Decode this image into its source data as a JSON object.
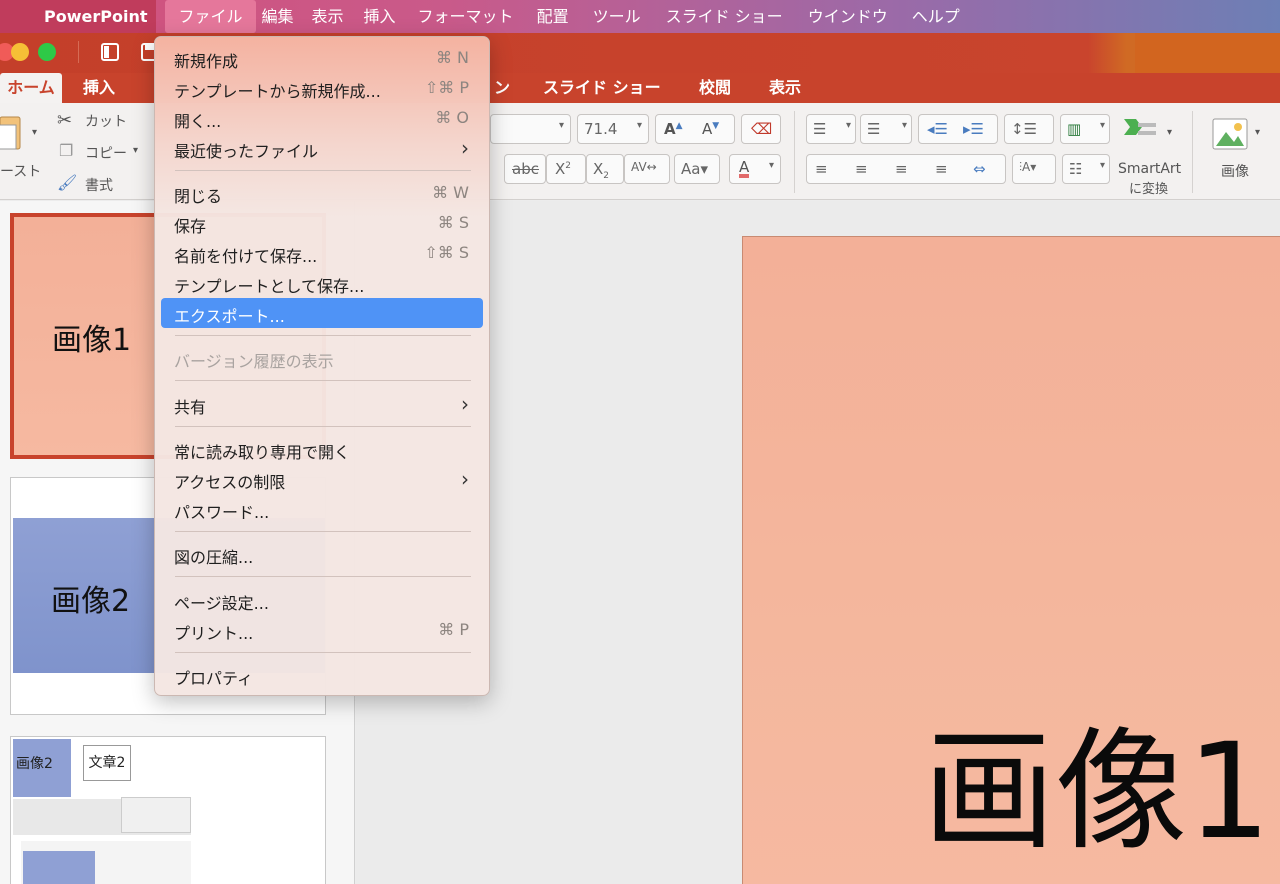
{
  "menubar": {
    "app": "PowerPoint",
    "items": [
      "ファイル",
      "編集",
      "表示",
      "挿入",
      "フォーマット",
      "配置",
      "ツール",
      "スライド ショー",
      "ウインドウ",
      "ヘルプ"
    ]
  },
  "ribbon_tabs": [
    "ホーム",
    "挿入",
    "ン",
    "スライド ショー",
    "校閲",
    "表示"
  ],
  "ribbon": {
    "paste": "ースト",
    "cut": "カット",
    "copy": "コピー",
    "format": "書式",
    "font_size": "71.4",
    "strikethrough": "abc",
    "smartart_line1": "SmartArt",
    "smartart_line2": "に変換",
    "picture": "画像"
  },
  "file_menu": {
    "items": [
      {
        "label": "新規作成",
        "shortcut": "⌘ N"
      },
      {
        "label": "テンプレートから新規作成...",
        "shortcut": "⇧⌘ P"
      },
      {
        "label": "開く...",
        "shortcut": "⌘ O"
      },
      {
        "label": "最近使ったファイル",
        "submenu": true
      },
      {
        "label": "閉じる",
        "shortcut": "⌘ W"
      },
      {
        "label": "保存",
        "shortcut": "⌘ S"
      },
      {
        "label": "名前を付けて保存...",
        "shortcut": "⇧⌘ S"
      },
      {
        "label": "テンプレートとして保存..."
      },
      {
        "label": "エクスポート...",
        "selected": true
      },
      {
        "label": "バージョン履歴の表示",
        "disabled": true
      },
      {
        "label": "共有",
        "submenu": true
      },
      {
        "label": "常に読み取り専用で開く"
      },
      {
        "label": "アクセスの制限",
        "submenu": true
      },
      {
        "label": "パスワード..."
      },
      {
        "label": "図の圧縮..."
      },
      {
        "label": "ページ設定..."
      },
      {
        "label": "プリント...",
        "shortcut": "⌘ P"
      },
      {
        "label": "プロパティ"
      }
    ]
  },
  "thumbnails": {
    "slide1": "画像1",
    "slide2": "画像2",
    "slide3_a": "画像2",
    "slide3_b": "文章2"
  },
  "slide": {
    "title": "画像1"
  },
  "colors": {
    "menubar_active": "#e5779b",
    "ribbon": "#c8432c",
    "selection": "#4f93f6",
    "slide1": "#f3b098",
    "slide2": "#8fa0d4"
  }
}
